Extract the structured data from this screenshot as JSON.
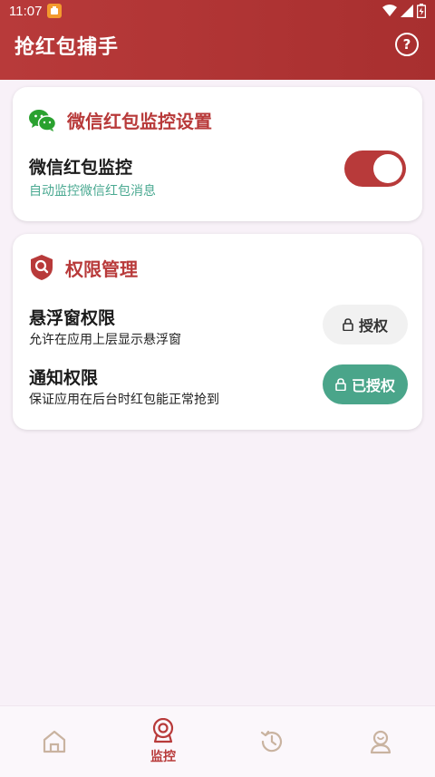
{
  "status_bar": {
    "time": "11:07"
  },
  "header": {
    "title": "抢红包捕手",
    "help_symbol": "?"
  },
  "wechat_card": {
    "title": "微信红包监控设置",
    "row_title": "微信红包监控",
    "row_subtitle": "自动监控微信红包消息",
    "toggle_on": true
  },
  "permission_card": {
    "title": "权限管理",
    "items": [
      {
        "title": "悬浮窗权限",
        "subtitle": "允许在应用上层显示悬浮窗",
        "button_label": "授权",
        "granted": false
      },
      {
        "title": "通知权限",
        "subtitle": "保证应用在后台时红包能正常抢到",
        "button_label": "已授权",
        "granted": true
      }
    ]
  },
  "bottom_nav": {
    "items": [
      {
        "icon": "home-icon",
        "label": ""
      },
      {
        "icon": "monitor-icon",
        "label": "监控",
        "active": true
      },
      {
        "icon": "history-icon",
        "label": ""
      },
      {
        "icon": "profile-icon",
        "label": ""
      }
    ]
  },
  "colors": {
    "brand_red": "#b83a3a",
    "teal": "#4aa991",
    "granted_green": "#4aa58a",
    "nav_inactive": "#c9b3a0"
  }
}
